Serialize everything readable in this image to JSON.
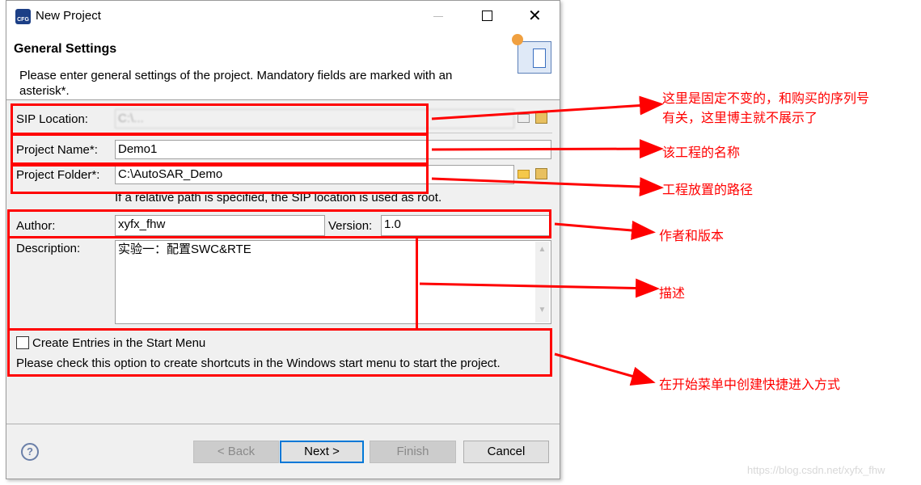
{
  "window": {
    "title": "New Project",
    "icon": "cfg-app-icon"
  },
  "header": {
    "title": "General Settings",
    "description": "Please enter general settings of the project. Mandatory fields are marked with an asterisk*.",
    "icon": "wizard-banner-icon"
  },
  "form": {
    "sip_location": {
      "label": "SIP Location:",
      "value": "C:\\..."
    },
    "project_name": {
      "label": "Project Name*:",
      "value": "Demo1"
    },
    "project_folder": {
      "label": "Project Folder*:",
      "value": "C:\\AutoSAR_Demo",
      "hint": "If a relative path is specified, the SIP location is used as root."
    },
    "author": {
      "label": "Author:",
      "value": "xyfx_fhw"
    },
    "version": {
      "label": "Version:",
      "value": "1.0"
    },
    "description": {
      "label": "Description:",
      "value": "实验一：配置SWC&RTE"
    },
    "start_menu": {
      "label": "Create Entries in the Start Menu",
      "checked": false,
      "hint": "Please check this option to create shortcuts in the Windows start menu to start the project."
    }
  },
  "footer": {
    "back": "< Back",
    "next": "Next >",
    "finish": "Finish",
    "cancel": "Cancel"
  },
  "annotations": {
    "sip_line1": "这里是固定不变的，和购买的序列号",
    "sip_line2": "有关，这里博主就不展示了",
    "name": "该工程的名称",
    "folder": "工程放置的路径",
    "author_version": "作者和版本",
    "description": "描述",
    "start_menu": "在开始菜单中创建快捷进入方式",
    "color": "#ff0000"
  },
  "watermark": "https://blog.csdn.net/xyfx_fhw"
}
